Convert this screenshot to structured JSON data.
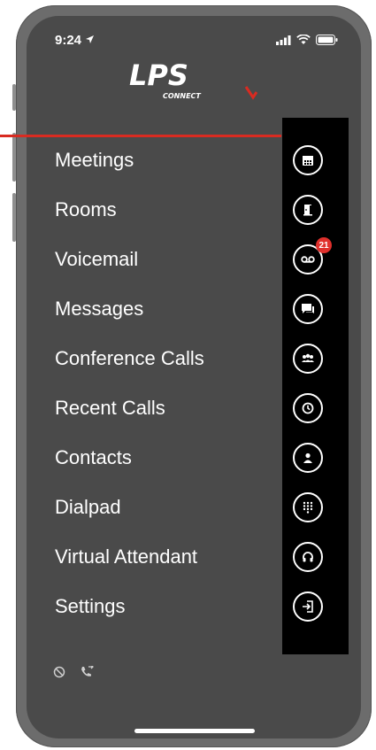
{
  "status_bar": {
    "time": "9:24"
  },
  "brand": {
    "name": "LPS",
    "tagline": "CONNECT",
    "accent_color": "#d92b21"
  },
  "menu": {
    "items": [
      {
        "label": "Meetings",
        "icon": "calendar-icon"
      },
      {
        "label": "Rooms",
        "icon": "door-icon"
      },
      {
        "label": "Voicemail",
        "icon": "voicemail-icon"
      },
      {
        "label": "Messages",
        "icon": "chat-icon"
      },
      {
        "label": "Conference Calls",
        "icon": "group-icon"
      },
      {
        "label": "Recent Calls",
        "icon": "clock-icon"
      },
      {
        "label": "Contacts",
        "icon": "person-icon"
      },
      {
        "label": "Dialpad",
        "icon": "dialpad-icon"
      },
      {
        "label": "Virtual Attendant",
        "icon": "headset-icon"
      },
      {
        "label": "Settings",
        "icon": "logout-icon"
      }
    ]
  },
  "voicemail": {
    "badge_count": "21",
    "badge_color": "#e0302c"
  },
  "colors": {
    "screen_bg": "#4a4a4a",
    "icon_bar_bg": "#000000",
    "frame": "#6c6c6c"
  }
}
